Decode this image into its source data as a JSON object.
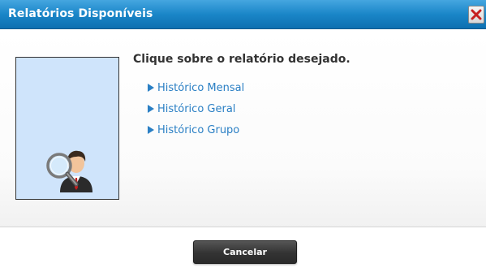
{
  "dialog": {
    "title": "Relatórios Disponíveis",
    "close_icon": "close-icon"
  },
  "main": {
    "illustration_icon": "user-search-icon",
    "heading": "Clique sobre o relatório desejado.",
    "reports": [
      {
        "label": "Histórico Mensal"
      },
      {
        "label": "Histórico Geral"
      },
      {
        "label": "Histórico Grupo"
      }
    ]
  },
  "footer": {
    "cancel_label": "Cancelar"
  },
  "colors": {
    "titlebar": "#1a86c8",
    "link": "#2a7fc4",
    "illustration_bg": "#cfe4fb",
    "cancel_bg": "#333333"
  }
}
